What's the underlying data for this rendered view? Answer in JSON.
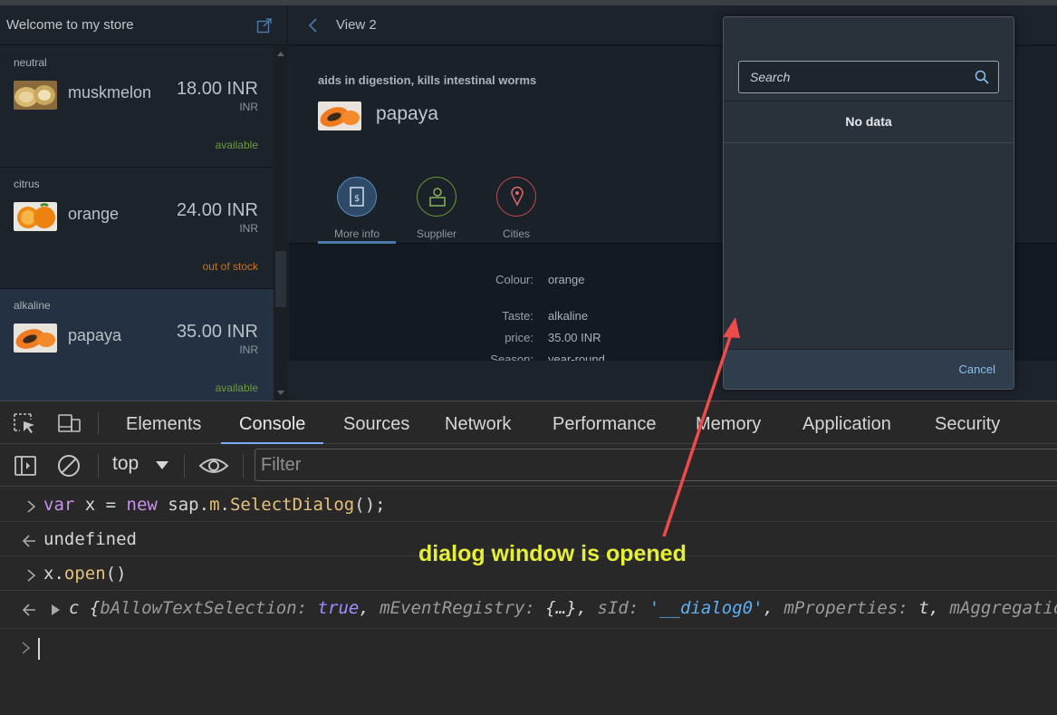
{
  "master": {
    "title": "Welcome to my store",
    "items": [
      {
        "category": "neutral",
        "name": "muskmelon",
        "price": "18.00 INR",
        "unit": "INR",
        "status": "available",
        "status_type": "ok"
      },
      {
        "category": "citrus",
        "name": "orange",
        "price": "24.00 INR",
        "unit": "INR",
        "status": "out of stock",
        "status_type": "bad"
      },
      {
        "category": "alkaline",
        "name": "papaya",
        "price": "35.00 INR",
        "unit": "INR",
        "status": "available",
        "status_type": "ok"
      }
    ]
  },
  "detail": {
    "title": "View 2",
    "subtitle": "aids in digestion, kills intestinal worms",
    "object_title": "papaya",
    "tabs": [
      {
        "label": "More info",
        "icon": "document-money-icon",
        "color": "#5a8cc0"
      },
      {
        "label": "Supplier",
        "icon": "supplier-icon",
        "color": "#6b9a3a"
      },
      {
        "label": "Cities",
        "icon": "map-pin-icon",
        "color": "#c44b4b"
      }
    ],
    "form": [
      {
        "key": "Colour:",
        "value": "orange"
      },
      {
        "key": "Taste:",
        "value": "alkaline"
      },
      {
        "key": "price:",
        "value": "35.00 INR"
      },
      {
        "key": "Season:",
        "value": "year-round"
      }
    ]
  },
  "dialog": {
    "search_placeholder": "Search",
    "no_data": "No data",
    "cancel": "Cancel"
  },
  "devtools": {
    "tabs": [
      "Elements",
      "Console",
      "Sources",
      "Network",
      "Performance",
      "Memory",
      "Application",
      "Security"
    ],
    "active_tab": "Console",
    "context": "top",
    "filter_placeholder": "Filter",
    "console": {
      "l1": {
        "kw1": "var",
        "t1": " x = ",
        "kw2": "new",
        "t2": " sap.",
        "fn1": "m",
        "t3": ".",
        "fn2": "SelectDialog",
        "t4": "();"
      },
      "l2": "undefined",
      "l3": {
        "t1": "x.",
        "fn": "open",
        "t2": "()"
      },
      "l4": {
        "cls": "c",
        "open": " {",
        "k1": "bAllowTextSelection",
        "v1": "true",
        "k2": "mEventRegistry",
        "v2": "{…}",
        "k3": "sId",
        "v3": "'__dialog0'",
        "k4": "mProperties",
        "v4": "t",
        "k5": "mAggregatio"
      }
    }
  },
  "annotation": "dialog window is opened",
  "colors": {
    "annotation": "#e6f034",
    "arrow": "#ef4a4a",
    "accent": "#7cacf8"
  }
}
